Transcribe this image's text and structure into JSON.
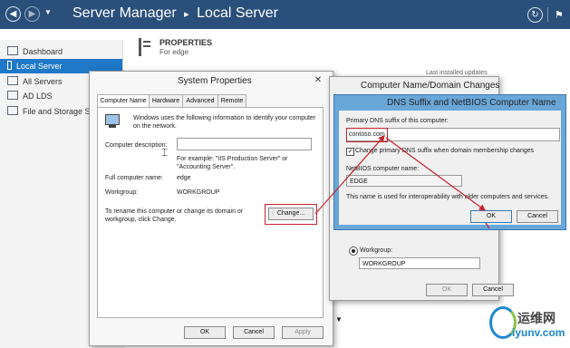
{
  "app": {
    "breadcrumb_parent": "Server Manager",
    "breadcrumb_separator": "▸",
    "breadcrumb_current": "Local Server",
    "colors": {
      "titlebar": "#2a4f7a",
      "selected": "#1f78c8",
      "callout": "#c8202a"
    }
  },
  "nav": {
    "items": [
      {
        "label": "Dashboard",
        "icon": "dashboard-icon"
      },
      {
        "label": "Local Server",
        "icon": "server-icon",
        "selected": true
      },
      {
        "label": "All Servers",
        "icon": "servers-icon"
      },
      {
        "label": "AD LDS",
        "icon": "ad-lds-icon"
      },
      {
        "label": "File and Storage Se",
        "icon": "storage-icon"
      }
    ]
  },
  "properties": {
    "title": "PROPERTIES",
    "subtitle": "For edge",
    "last_installed_label": "Last installed updates"
  },
  "system_properties": {
    "title": "System Properties",
    "tabs": [
      "Computer Name",
      "Hardware",
      "Advanced",
      "Remote"
    ],
    "intro": "Windows uses the following information to identify your computer on the network.",
    "description_label": "Computer description:",
    "description_value": "",
    "example": "For example: \"IIS Production Server\" or \"Accounting Server\".",
    "full_name_label": "Full computer name:",
    "full_name_value": "edge",
    "workgroup_label": "Workgroup:",
    "workgroup_value": "WORKGROUP",
    "rename_text": "To rename this computer or change its domain or workgroup, click Change.",
    "change_button": "Change...",
    "ok": "OK",
    "cancel": "Cancel",
    "apply": "Apply"
  },
  "domain_changes": {
    "title": "Computer Name/Domain Changes",
    "workgroup_label": "Workgroup:",
    "workgroup_value": "WORKGROUP",
    "ok": "OK",
    "cancel": "Cancel"
  },
  "dns_suffix": {
    "title": "DNS Suffix and NetBIOS Computer Name",
    "primary_label": "Primary DNS suffix of this computer:",
    "primary_value": "contoso.com",
    "change_checkbox": "Change primary DNS suffix when domain membership changes",
    "netbios_label": "NetBIOS computer name:",
    "netbios_value": "EDGE",
    "note": "This name is used for interoperability with older computers and services.",
    "ok": "OK",
    "cancel": "Cancel"
  },
  "watermark": {
    "chinese": "运维网",
    "latin": "iyunv.com"
  }
}
